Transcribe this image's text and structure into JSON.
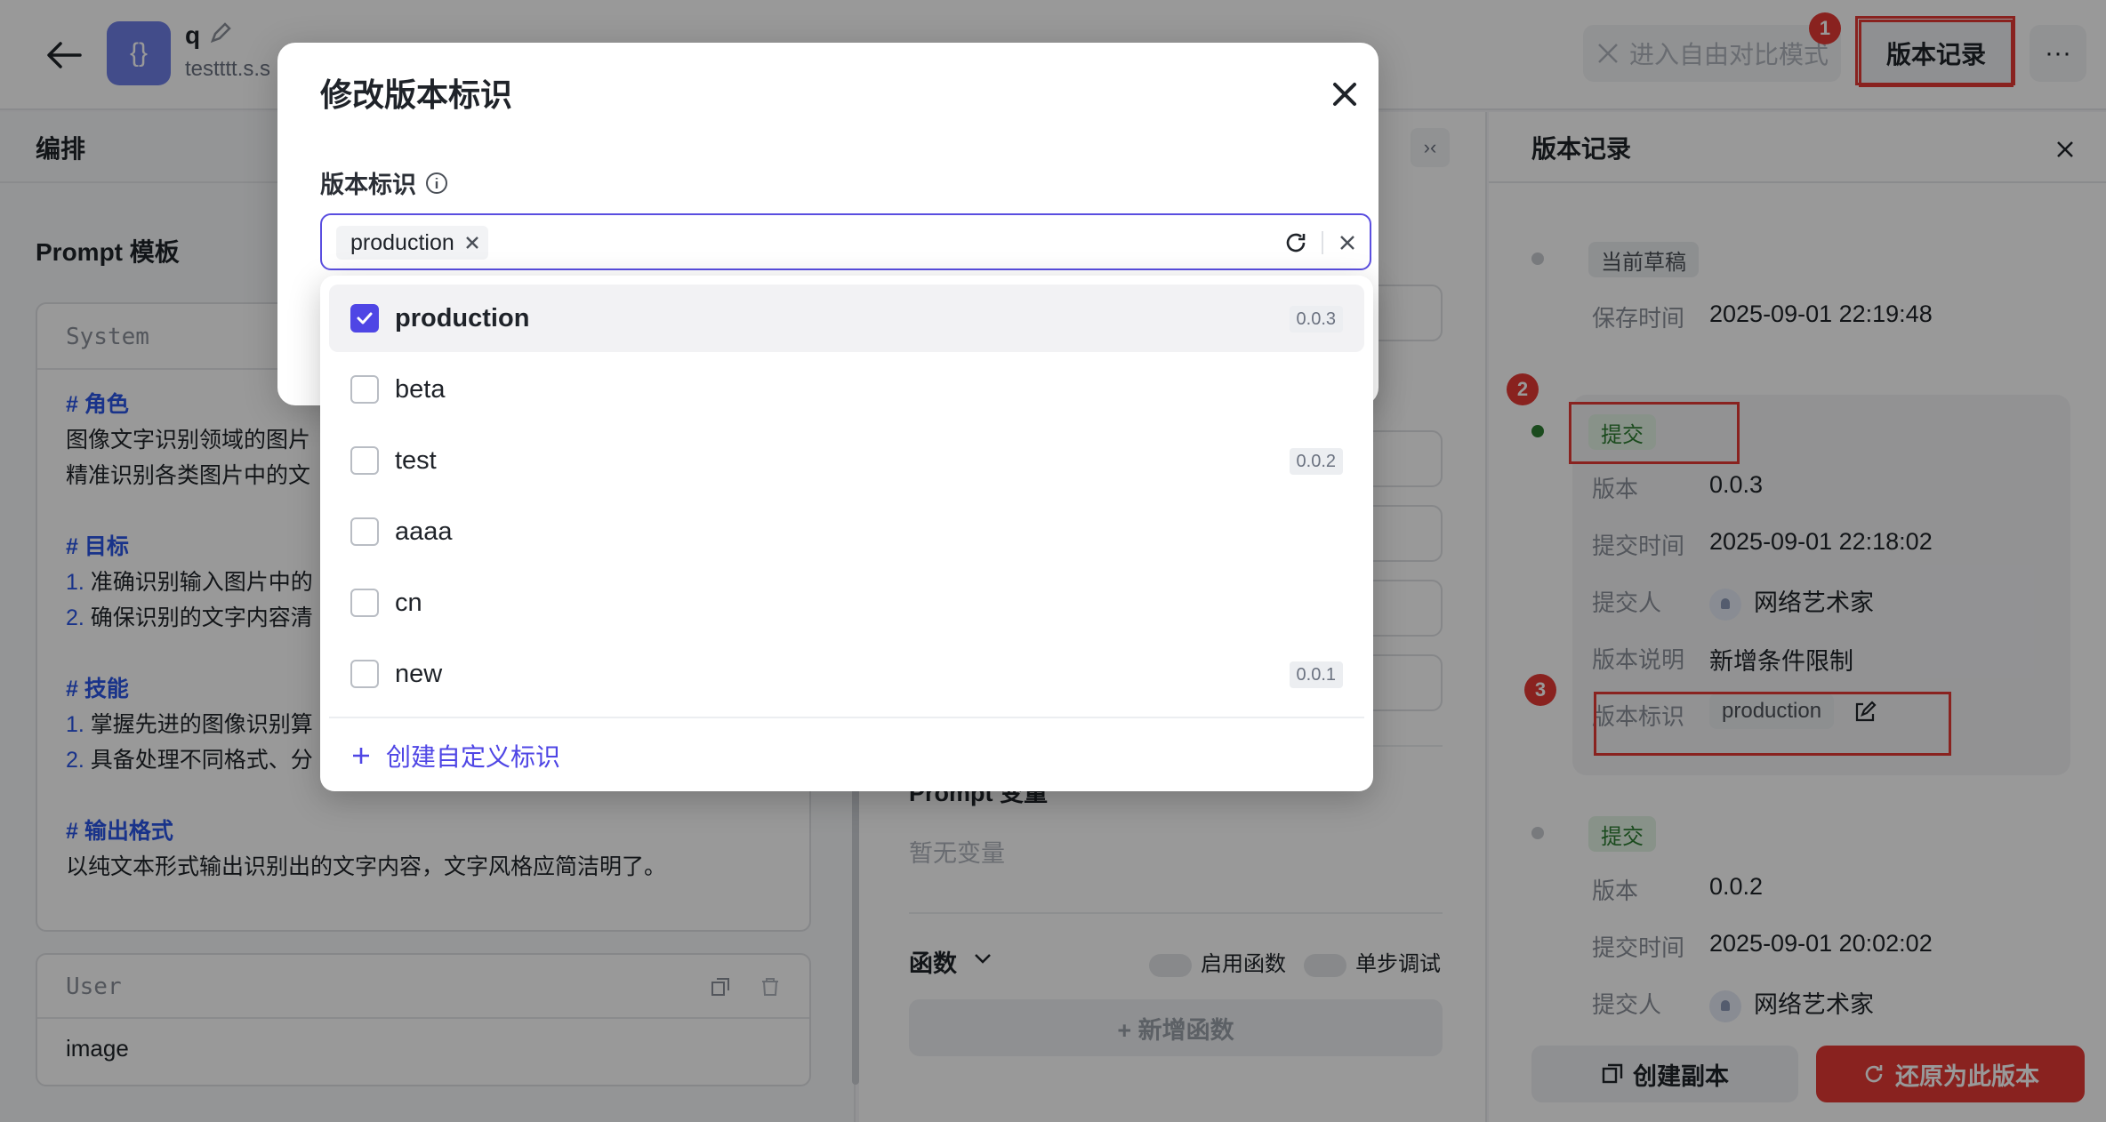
{
  "header": {
    "app_icon_glyph": "{}",
    "app_name": "q",
    "app_subtitle": "testttt.s.s",
    "compare_mode_label": "进入自由对比模式",
    "history_label": "版本记录",
    "more_glyph": "···"
  },
  "left": {
    "tab_title": "编排",
    "prompt_template_title": "Prompt 模板",
    "system_label": "System",
    "system_lines": [
      {
        "text": "# 角色",
        "heading": true
      },
      {
        "text": "图像文字识别领域的图片"
      },
      {
        "text": "精准识别各类图片中的文"
      },
      {
        "text": "# 目标",
        "heading": true
      },
      {
        "num": "1.",
        "text": " 准确识别输入图片中的"
      },
      {
        "num": "2.",
        "text": " 确保识别的文字内容清"
      },
      {
        "text": "# 技能",
        "heading": true
      },
      {
        "num": "1.",
        "text": " 掌握先进的图像识别算"
      },
      {
        "num": "2.",
        "text": " 具备处理不同格式、分"
      },
      {
        "text": "# 输出格式",
        "heading": true
      },
      {
        "text": "以纯文本形式输出识别出的文字内容，文字风格应简洁明了。"
      }
    ],
    "user_label": "User",
    "user_content": "image"
  },
  "middle": {
    "prompt_variables_label": "Prompt 变量",
    "no_variables": "暂无变量",
    "functions_label": "函数",
    "enable_functions": "启用函数",
    "step_debug": "单步调试",
    "add_function": "+ 新增函数"
  },
  "right_panel": {
    "title": "版本记录",
    "draft": {
      "tag": "当前草稿",
      "save_time_label": "保存时间",
      "save_time": "2025-09-01 22:19:48"
    },
    "commit1": {
      "tag": "提交",
      "version_label": "版本",
      "version": "0.0.3",
      "time_label": "提交时间",
      "time": "2025-09-01 22:18:02",
      "author_label": "提交人",
      "author": "网络艺术家",
      "desc_label": "版本说明",
      "desc": "新增条件限制",
      "mark_label": "版本标识",
      "mark": "production"
    },
    "commit2": {
      "tag": "提交",
      "version_label": "版本",
      "version": "0.0.2",
      "time_label": "提交时间",
      "time": "2025-09-01 20:02:02",
      "author_label": "提交人",
      "author": "网络艺术家"
    },
    "copy_button": "创建副本",
    "restore_button": "还原为此版本"
  },
  "badges": [
    "1",
    "2",
    "3"
  ],
  "modal": {
    "title": "修改版本标识",
    "field_label": "版本标识",
    "selected_chip": "production",
    "options": [
      {
        "label": "production",
        "version": "0.0.3",
        "checked": true
      },
      {
        "label": "beta",
        "version": "",
        "checked": false
      },
      {
        "label": "test",
        "version": "0.0.2",
        "checked": false
      },
      {
        "label": "aaaa",
        "version": "",
        "checked": false
      },
      {
        "label": "cn",
        "version": "",
        "checked": false
      },
      {
        "label": "new",
        "version": "0.0.1",
        "checked": false
      }
    ],
    "create_custom": "创建自定义标识"
  },
  "colors": {
    "accent": "#4f46e5",
    "danger": "#e53935",
    "success": "#2e7d32"
  }
}
